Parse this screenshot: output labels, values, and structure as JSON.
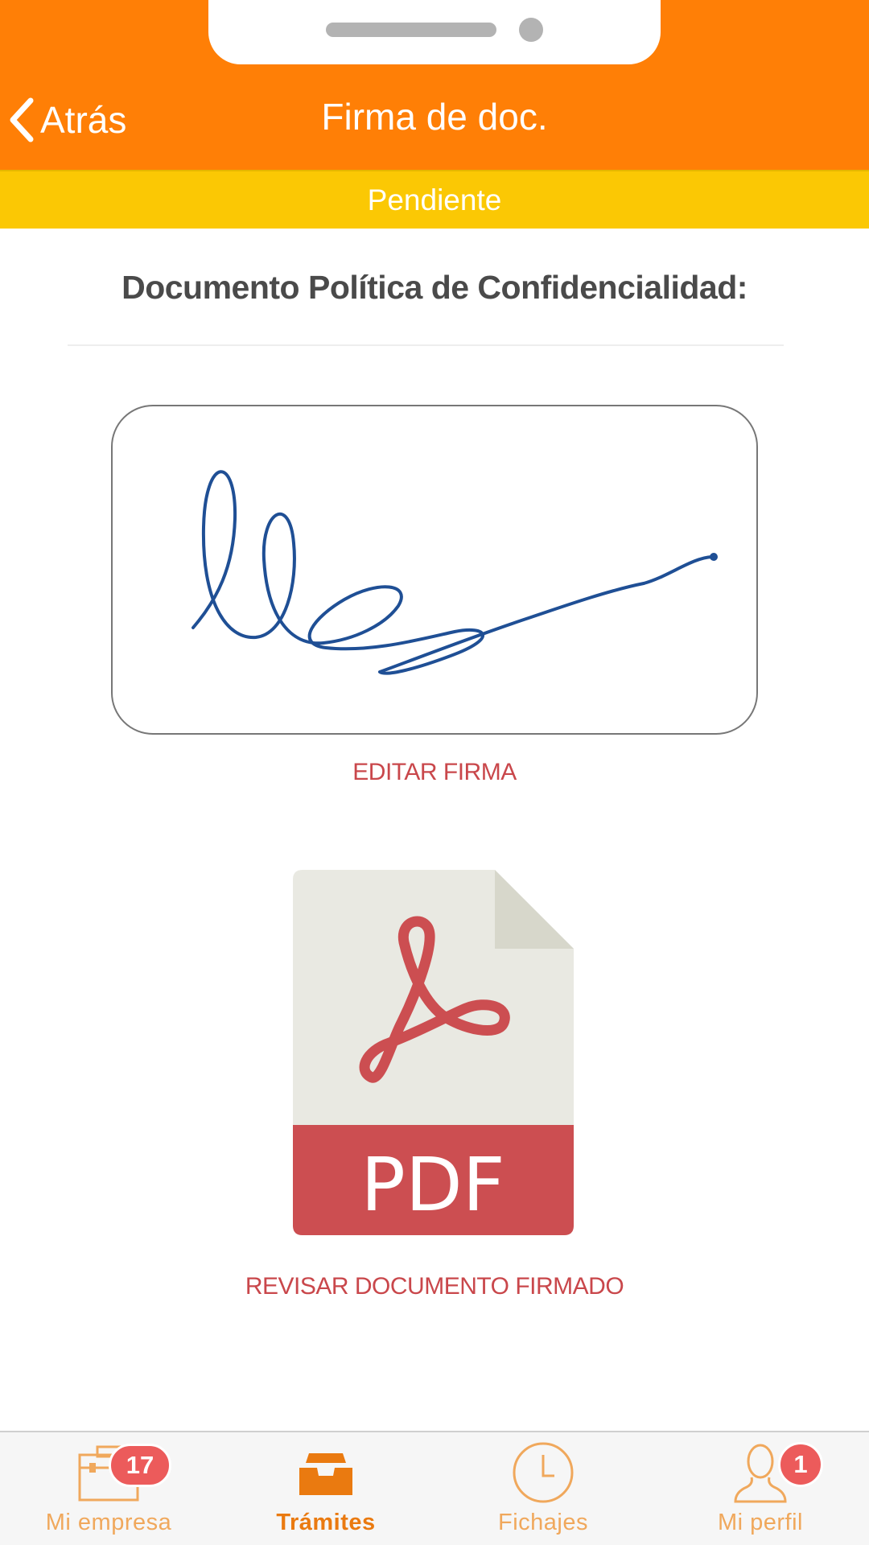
{
  "header": {
    "back_label": "Atrás",
    "title": "Firma de doc."
  },
  "status": {
    "label": "Pendiente"
  },
  "document": {
    "title": "Documento Política de Confidencialidad:",
    "edit_signature_label": "EDITAR FIRMA",
    "pdf_label": "PDF",
    "review_label": "REVISAR DOCUMENTO FIRMADO"
  },
  "tabbar": {
    "tabs": [
      {
        "label": "Mi empresa",
        "icon": "briefcase-icon",
        "badge": "17",
        "active": false
      },
      {
        "label": "Trámites",
        "icon": "inbox-tray-icon",
        "badge": "",
        "active": true
      },
      {
        "label": "Fichajes",
        "icon": "clock-icon",
        "badge": "",
        "active": false
      },
      {
        "label": "Mi perfil",
        "icon": "user-icon",
        "badge": "1",
        "active": false
      }
    ]
  },
  "colors": {
    "header": "#ff7f06",
    "status_bar": "#fbc804",
    "link": "#c9474b",
    "signature_ink": "#1f4f95",
    "badge": "#ec5b5b",
    "tab_inactive": "#f0a85c",
    "tab_active": "#ea7a10"
  }
}
